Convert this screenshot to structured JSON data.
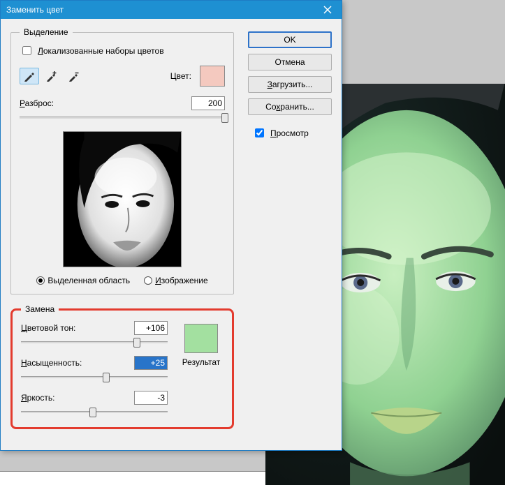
{
  "title": "Заменить цвет",
  "selection_group": {
    "legend": "Выделение",
    "localized_sets_label": "Локализованные наборы цветов",
    "localized_sets_checked": false,
    "color_label": "Цвет:",
    "color_hex": "#f4c9bf",
    "fuzziness_label": "Разброс:",
    "fuzziness_value": "200",
    "fuzziness_percent": 100,
    "radio_selection": "Выделенная область",
    "radio_image": "Изображение",
    "radio_selected": "selection"
  },
  "replace_group": {
    "legend": "Замена",
    "hue_label": "Цветовой тон:",
    "hue_value": "+106",
    "hue_percent": 79,
    "sat_label": "Насыщенность:",
    "sat_value": "+25",
    "sat_percent": 58,
    "light_label": "Яркость:",
    "light_value": "-3",
    "light_percent": 49,
    "result_label": "Результат",
    "result_hex": "#a3e0a0"
  },
  "buttons": {
    "ok": "OK",
    "cancel": "Отмена",
    "load": "Загрузить...",
    "save": "Сохранить...",
    "preview": "Просмотр",
    "preview_checked": true
  }
}
